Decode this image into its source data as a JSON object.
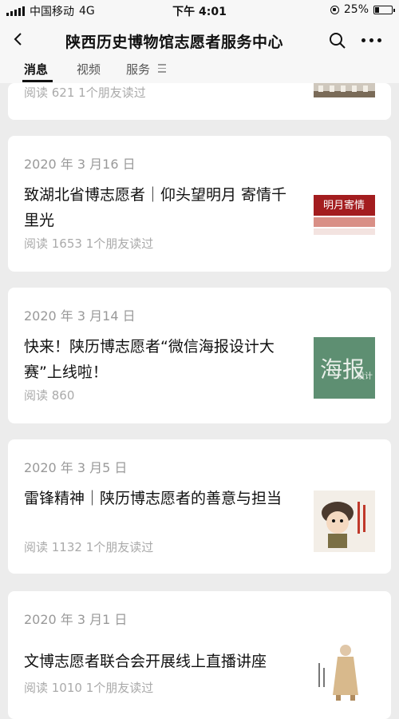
{
  "status_bar": {
    "carrier": "中国移动",
    "network": "4G",
    "time": "下午 4:01",
    "battery": "25%",
    "battery_level": 0.25
  },
  "navbar": {
    "title": "陕西历史博物馆志愿者服务中心"
  },
  "tabs": [
    {
      "label": "消息"
    },
    {
      "label": "视频"
    },
    {
      "label": "服务"
    }
  ],
  "articles": [
    {
      "date": "",
      "title": "",
      "meta": "阅读 621  1个朋友读过",
      "thumb": "building-photo"
    },
    {
      "date": "2020 年 3 月16 日",
      "title": "致湖北省博志愿者｜仰头望明月 寄情千里光",
      "meta": "阅读 1653  1个朋友读过",
      "thumb": "poem-banner-thumbnail",
      "thumb_text": "明月寄情"
    },
    {
      "date": "2020 年 3 月14 日",
      "title": "快来！陕历博志愿者“微信海报设计大赛”上线啦！",
      "meta": "阅读 860",
      "thumb": "poster-contest-thumbnail",
      "thumb_text": "海报",
      "thumb_text2": "设计"
    },
    {
      "date": "2020 年 3 月5 日",
      "title": "雷锋精神｜陕历博志愿者的善意与担当",
      "meta": "阅读 1132  1个朋友读过",
      "thumb": "lei-feng-illustration"
    },
    {
      "date": "2020 年 3 月1 日",
      "title": "文博志愿者联合会开展线上直播讲座",
      "meta": "阅读 1010  1个朋友读过",
      "thumb": "figurine-illustration"
    }
  ]
}
